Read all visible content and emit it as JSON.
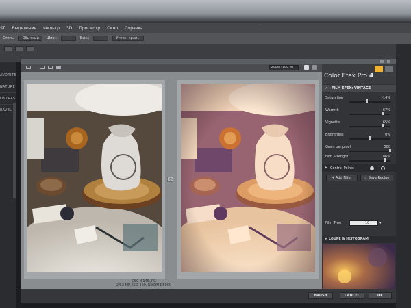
{
  "menu_bar": {
    "items": [
      "ST",
      "Выделение",
      "Фильтр",
      "3D",
      "Просмотр",
      "Окно",
      "Справка"
    ]
  },
  "options_bar": {
    "label_style": "Стиль:",
    "style_value": "Обычный",
    "width_label": "Шир.:",
    "height_label": "Выс.:",
    "refine_edge": "Уточн. край..."
  },
  "left_panel": {
    "items": [
      "AVORITES",
      "NATURE",
      "ONTRAST",
      "RAVEL"
    ]
  },
  "nik_window": {
    "zoom_value": "Zoom (100 %)",
    "caption_filename": "DSC_6146.JPG",
    "caption_meta": "24.3 MP, ISO 400, NIKON D5000",
    "split_handle": "◁▷",
    "bottom_buttons": {
      "brush": "BRUSH",
      "cancel": "CANCEL",
      "ok": "OK"
    }
  },
  "panel": {
    "title_prefix": "Color Efex Pro",
    "title_version": "4",
    "filter_check": "✓",
    "filter_name": "FILM EFEX: VINTAGE",
    "sliders": [
      {
        "label": "Saturation",
        "value": "-14%",
        "level": 0.43
      },
      {
        "label": "Warmth",
        "value": "67%",
        "level": 0.83
      },
      {
        "label": "Vignette",
        "value": "65%",
        "level": 0.82
      },
      {
        "label": "Brightness",
        "value": "0%",
        "level": 0.5
      },
      {
        "label": "Grain per pixel",
        "value": "500",
        "level": 0.99
      },
      {
        "label": "Film Strength",
        "value": "86%",
        "level": 0.86
      }
    ],
    "film_type_label": "Film Type",
    "film_type_value": "10",
    "control_points_label": "Control Points",
    "add_filter": "+ Add Filter",
    "save_recipe": "☆ Save Recipe",
    "loupe_label": "LOUPE & HISTOGRAM",
    "colors": {
      "accent_badge": "#f0b232"
    }
  }
}
